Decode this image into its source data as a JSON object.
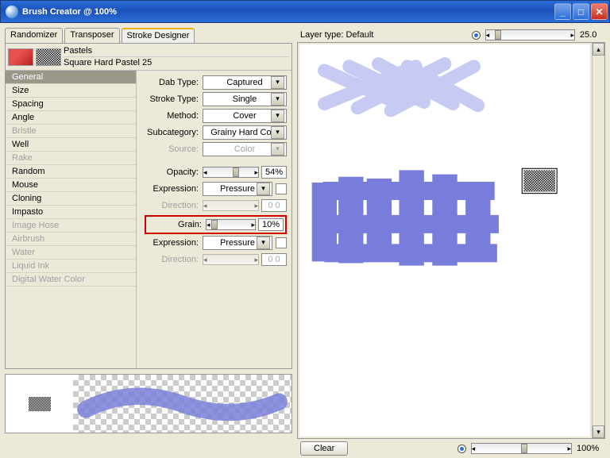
{
  "window": {
    "title": "Brush Creator @ 100%"
  },
  "tabs": [
    "Randomizer",
    "Transposer",
    "Stroke Designer"
  ],
  "activeTab": 2,
  "brush": {
    "category": "Pastels",
    "variant": "Square Hard Pastel 25"
  },
  "categories": [
    {
      "label": "General",
      "sel": true
    },
    {
      "label": "Size"
    },
    {
      "label": "Spacing"
    },
    {
      "label": "Angle"
    },
    {
      "label": "Bristle",
      "dis": true
    },
    {
      "label": "Well"
    },
    {
      "label": "Rake",
      "dis": true
    },
    {
      "label": "Random"
    },
    {
      "label": "Mouse"
    },
    {
      "label": "Cloning"
    },
    {
      "label": "Impasto"
    },
    {
      "label": "Image Hose",
      "dis": true
    },
    {
      "label": "Airbrush",
      "dis": true
    },
    {
      "label": "Water",
      "dis": true
    },
    {
      "label": "Liquid Ink",
      "dis": true
    },
    {
      "label": "Digital Water Color",
      "dis": true
    }
  ],
  "props": {
    "dabType": {
      "label": "Dab Type:",
      "value": "Captured"
    },
    "strokeType": {
      "label": "Stroke Type:",
      "value": "Single"
    },
    "method": {
      "label": "Method:",
      "value": "Cover"
    },
    "subcategory": {
      "label": "Subcategory:",
      "value": "Grainy Hard Co..."
    },
    "source": {
      "label": "Source:",
      "value": "Color"
    },
    "opacity": {
      "label": "Opacity:",
      "value": "54%",
      "pct": 54
    },
    "expression1": {
      "label": "Expression:",
      "value": "Pressure"
    },
    "direction1": {
      "label": "Direction:",
      "value": "0 0"
    },
    "grain": {
      "label": "Grain:",
      "value": "10%",
      "pct": 10
    },
    "expression2": {
      "label": "Expression:",
      "value": "Pressure"
    },
    "direction2": {
      "label": "Direction:",
      "value": "0 0"
    }
  },
  "layer": {
    "label": "Layer type: Default",
    "sliderValue": "25.0",
    "pct": 10
  },
  "bottom": {
    "clear": "Clear",
    "zoom": "100%",
    "pct": 50
  },
  "colors": {
    "stroke": "#8a90e0",
    "stroke2": "#6a70d8"
  }
}
